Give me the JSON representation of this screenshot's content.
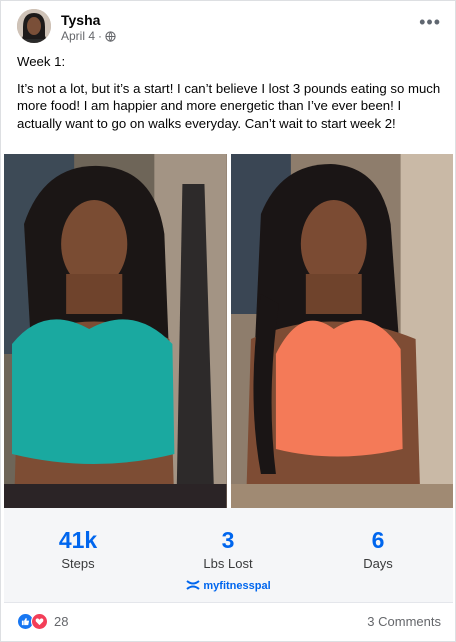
{
  "post": {
    "author": "Tysha",
    "date": "April 4",
    "separator": "·",
    "menu_icon": "more-horizontal-icon",
    "privacy_icon": "globe-icon",
    "paragraphs": [
      "Week 1:",
      "It’s not a lot, but it’s a start! I can’t believe I lost 3 pounds eating so much more food! I am happier and more energetic than I’ve ever been! I actually want to go on walks everyday. Can’t wait to start week 2!"
    ]
  },
  "photos": [
    {
      "name": "before-photo",
      "top_color": "#1aa9a0"
    },
    {
      "name": "after-photo",
      "top_color": "#f47a58"
    }
  ],
  "stats": [
    {
      "value": "41k",
      "label": "Steps"
    },
    {
      "value": "3",
      "label": "Lbs Lost"
    },
    {
      "value": "6",
      "label": "Days"
    }
  ],
  "brand": {
    "text": "myfitnesspal",
    "icon": "underarmour-logo-icon",
    "color": "#0066ee"
  },
  "footer": {
    "reaction_count": "28",
    "reaction_icons": [
      "like-icon",
      "love-icon"
    ],
    "comments": "3 Comments"
  }
}
